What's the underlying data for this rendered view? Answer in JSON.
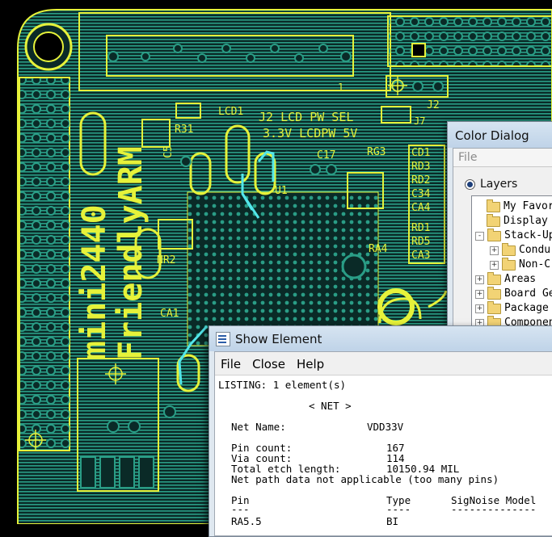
{
  "board_silkscreen": {
    "board_name_line1": "mini2440",
    "board_name_line2": "FriendlyARM",
    "lcd_label": "J2 LCD PW SEL",
    "lcd_voltages": "3.3V LCDPW 5V",
    "j2": "J2",
    "lcd1": "LCD1",
    "r31": "R31",
    "nr2": "NR2",
    "ca1": "CA1",
    "ra4": "RA4",
    "rg3": "RG3",
    "cd1": "CD1",
    "rd3": "RD3",
    "rd2": "RD2",
    "c34": "C34",
    "ca4": "CA4",
    "rd1": "RD1",
    "rd5": "RD5",
    "ca3": "CA3",
    "j7": "J7",
    "u1": "U1",
    "c17": "C17",
    "c5": "C5",
    "one": "1",
    "colors": {
      "background": "#000000",
      "copper": "#2a9d86",
      "copper_dark": "#0f3d38",
      "silk": "#e6f23a",
      "highlight": "#53e6ea"
    }
  },
  "color_dialog": {
    "title": "Color Dialog",
    "menu": [
      "File"
    ],
    "radio_label": "Layers",
    "tree": [
      {
        "label": "My Favor",
        "indent": 1,
        "expander": ""
      },
      {
        "label": "Display",
        "indent": 1,
        "expander": ""
      },
      {
        "label": "Stack-Up",
        "indent": 0,
        "expander": "-"
      },
      {
        "label": "Condu",
        "indent": 1,
        "expander": "+"
      },
      {
        "label": "Non-C",
        "indent": 1,
        "expander": "+"
      },
      {
        "label": "Areas",
        "indent": 0,
        "expander": "+"
      },
      {
        "label": "Board Ge",
        "indent": 0,
        "expander": "+"
      },
      {
        "label": "Package",
        "indent": 0,
        "expander": "+"
      },
      {
        "label": "Componen",
        "indent": 0,
        "expander": "+"
      }
    ]
  },
  "show_element": {
    "title": "Show Element",
    "menu": [
      "File",
      "Close",
      "Help"
    ],
    "listing_header": "LISTING: 1 element(s)",
    "net_heading": "< NET >",
    "net_name_label": "Net Name:",
    "net_name": "VDD33V",
    "pin_count_label": "Pin count:",
    "pin_count": "167",
    "via_count_label": "Via count:",
    "via_count": "114",
    "etch_label": "Total etch length:",
    "etch_length": "10150.94 MIL",
    "net_path_note": "Net path data not applicable (too many pins)",
    "table_headers": [
      "Pin",
      "Type",
      "SigNoise Model"
    ],
    "table_rules": [
      "---",
      "----",
      "--------------"
    ],
    "rows": [
      {
        "pin": "RA5.5",
        "type": "BI",
        "model": ""
      }
    ]
  }
}
